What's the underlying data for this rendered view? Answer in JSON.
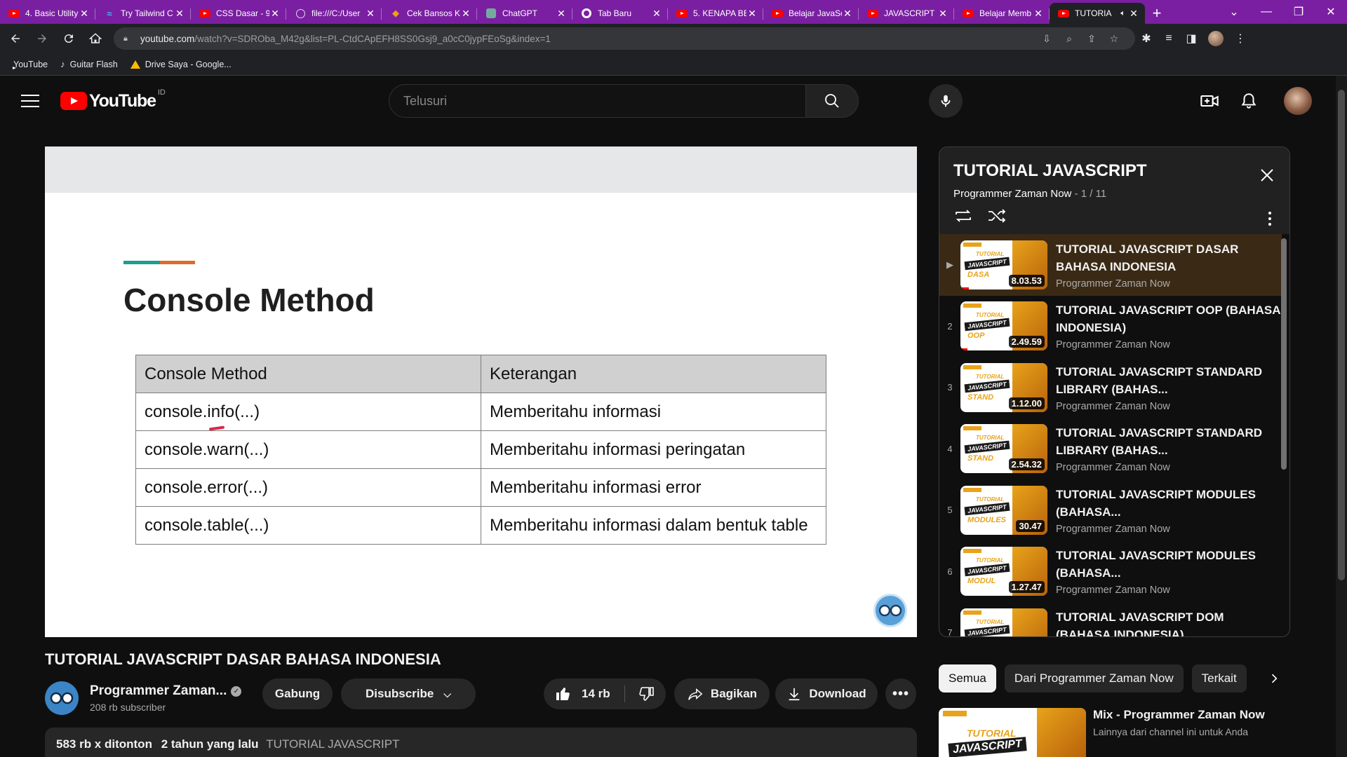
{
  "browser": {
    "tabs": [
      {
        "title": "4. Basic Utility",
        "icon": "youtube-icon"
      },
      {
        "title": "Try Tailwind C",
        "icon": "tailwind-icon"
      },
      {
        "title": "CSS Dasar - 9",
        "icon": "youtube-icon"
      },
      {
        "title": "file:///C:/User",
        "icon": "globe-icon"
      },
      {
        "title": "Cek Bansos K",
        "icon": "app-icon"
      },
      {
        "title": "ChatGPT",
        "icon": "chatgpt-icon"
      },
      {
        "title": "Tab Baru",
        "icon": "chrome-icon"
      },
      {
        "title": "5. KENAPA BE",
        "icon": "youtube-icon"
      },
      {
        "title": "Belajar JavaSc",
        "icon": "youtube-icon"
      },
      {
        "title": "JAVASCRIPT L",
        "icon": "youtube-icon"
      },
      {
        "title": "Belajar Memb",
        "icon": "youtube-icon"
      },
      {
        "title": "TUTORIA",
        "icon": "youtube-icon",
        "active": true,
        "audio": true
      }
    ],
    "url_host": "youtube.com",
    "url_path": "/watch?v=SDROba_M42g&list=PL-CtdCApEFH8SS0Gsj9_a0cC0jypFEoSg&index=1",
    "bookmarks": [
      {
        "label": "YouTube",
        "icon": "youtube-icon"
      },
      {
        "label": "Guitar Flash",
        "icon": "guitar-icon"
      },
      {
        "label": "Drive Saya - Google...",
        "icon": "drive-icon"
      }
    ]
  },
  "youtube": {
    "region": "ID",
    "logo_word": "YouTube",
    "search_placeholder": "Telusuri"
  },
  "slide": {
    "title": "Console Method",
    "accent_colors": [
      "#1e9e8e",
      "#e06a2c"
    ],
    "table_headers": [
      "Console Method",
      "Keterangan"
    ],
    "table_rows": [
      [
        "console.info(...)",
        "Memberitahu informasi"
      ],
      [
        "console.warn(...)",
        "Memberitahu informasi peringatan"
      ],
      [
        "console.error(...)",
        "Memberitahu informasi error"
      ],
      [
        "console.table(...)",
        "Memberitahu informasi dalam bentuk table"
      ]
    ]
  },
  "video": {
    "title": "TUTORIAL JAVASCRIPT DASAR BAHASA INDONESIA",
    "channel": "Programmer Zaman...",
    "subscribers": "208 rb subscriber",
    "join": "Gabung",
    "subscribe": "Disubscribe",
    "likes": "14 rb",
    "share": "Bagikan",
    "download": "Download",
    "views": "583 rb x ditonton",
    "age": "2 tahun yang lalu",
    "tag": "TUTORIAL JAVASCRIPT"
  },
  "playlist": {
    "title": "TUTORIAL JAVASCRIPT",
    "owner": "Programmer Zaman Now",
    "position": "1 / 11",
    "items": [
      {
        "index": "▶",
        "title": "TUTORIAL JAVASCRIPT DASAR BAHASA INDONESIA",
        "channel": "Programmer Zaman Now",
        "duration": "8.03.53",
        "thumb_word": "DASA",
        "current": true
      },
      {
        "index": "2",
        "title": "TUTORIAL JAVASCRIPT OOP (BAHASA INDONESIA)",
        "channel": "Programmer Zaman Now",
        "duration": "2.49.59",
        "thumb_word": "OOP"
      },
      {
        "index": "3",
        "title": "TUTORIAL JAVASCRIPT STANDARD LIBRARY (BAHAS...",
        "channel": "Programmer Zaman Now",
        "duration": "1.12.00",
        "thumb_word": "STAND"
      },
      {
        "index": "4",
        "title": "TUTORIAL JAVASCRIPT STANDARD LIBRARY (BAHAS...",
        "channel": "Programmer Zaman Now",
        "duration": "2.54.32",
        "thumb_word": "STAND"
      },
      {
        "index": "5",
        "title": "TUTORIAL JAVASCRIPT MODULES (BAHASA...",
        "channel": "Programmer Zaman Now",
        "duration": "30.47",
        "thumb_word": "MODULES"
      },
      {
        "index": "6",
        "title": "TUTORIAL JAVASCRIPT MODULES (BAHASA...",
        "channel": "Programmer Zaman Now",
        "duration": "1.27.47",
        "thumb_word": "MODUL"
      },
      {
        "index": "7",
        "title": "TUTORIAL JAVASCRIPT DOM (BAHASA INDONESIA)",
        "channel": "Programmer Zaman Now",
        "duration": "",
        "thumb_word": ""
      }
    ]
  },
  "chips": [
    "Semua",
    "Dari Programmer Zaman Now",
    "Terkait"
  ],
  "recommendation": {
    "title": "Mix - Programmer Zaman Now",
    "subtitle": "Lainnya dari channel ini untuk Anda"
  },
  "colors": {
    "youtube_red": "#ff0000",
    "tab_strip": "#7a1fa2",
    "bg": "#0f0f0f",
    "accent_orange": "#e8a31a"
  }
}
